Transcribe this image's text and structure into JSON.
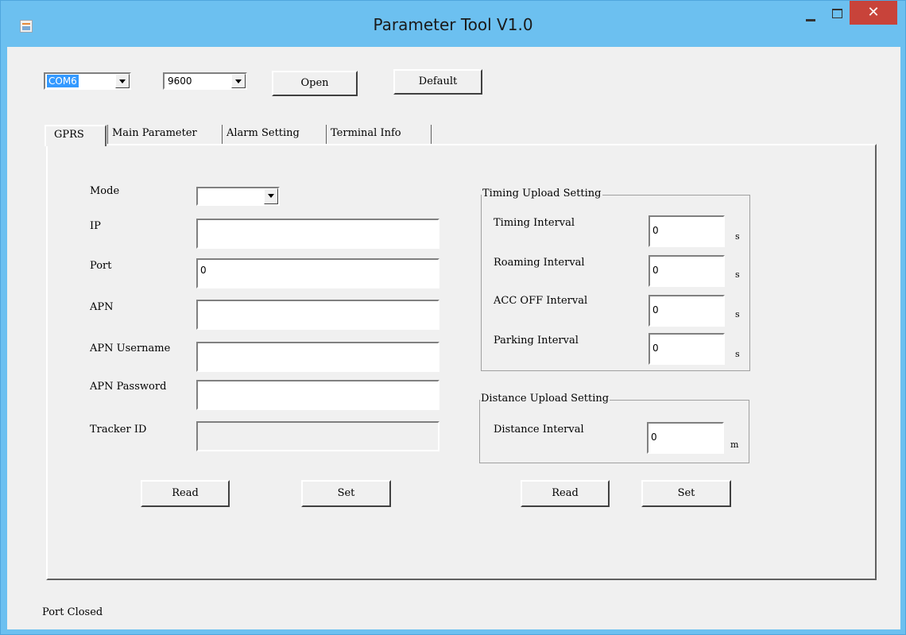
{
  "window": {
    "title": "Parameter Tool V1.0",
    "close_glyph": "✕"
  },
  "toolbar": {
    "port": "COM6",
    "baud": "9600",
    "open_label": "Open",
    "default_label": "Default"
  },
  "tabs": [
    {
      "label": "GPRS",
      "active": true
    },
    {
      "label": "Main Parameter",
      "active": false
    },
    {
      "label": "Alarm Setting",
      "active": false
    },
    {
      "label": "Terminal Info",
      "active": false
    }
  ],
  "gprs": {
    "mode_label": "Mode",
    "mode_value": "",
    "ip_label": "IP",
    "ip_value": "",
    "port_label": "Port",
    "port_value": "0",
    "apn_label": "APN",
    "apn_value": "",
    "apn_user_label": "APN Username",
    "apn_user_value": "",
    "apn_pass_label": "APN Password",
    "apn_pass_value": "",
    "tracker_label": "Tracker ID",
    "tracker_value": "",
    "read_label": "Read",
    "set_label": "Set"
  },
  "timing": {
    "title": "Timing Upload Setting",
    "timing_label": "Timing Interval",
    "timing_value": "0",
    "roaming_label": "Roaming Interval",
    "roaming_value": "0",
    "accoff_label": "ACC OFF Interval",
    "accoff_value": "0",
    "parking_label": "Parking Interval",
    "parking_value": "0",
    "unit": "s"
  },
  "distance": {
    "title": "Distance Upload Setting",
    "interval_label": "Distance Interval",
    "interval_value": "0",
    "unit": "m"
  },
  "upload": {
    "read_label": "Read",
    "set_label": "Set"
  },
  "status": "Port Closed"
}
